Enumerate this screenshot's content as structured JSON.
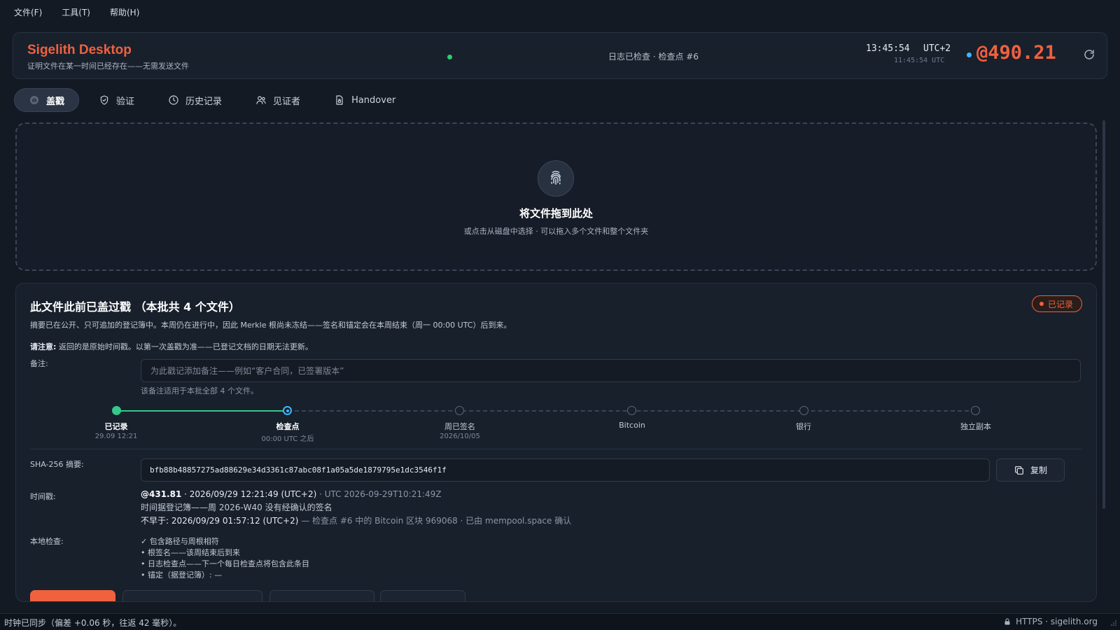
{
  "menu": {
    "file": "文件(F)",
    "tools": "工具(T)",
    "help": "帮助(H)"
  },
  "header": {
    "title": "Sigelith Desktop",
    "subtitle": "证明文件在某一时间已经存在——无需发送文件",
    "log_status": "日志已检查 · 检查点 #6",
    "clock_local": "13:45:54",
    "clock_tz": "UTC+2",
    "clock_utc": "11:45:54 UTC",
    "beat": "@490.21"
  },
  "tabs": [
    {
      "label": "盖戳",
      "icon": "fingerprint-icon",
      "active": true
    },
    {
      "label": "验证",
      "icon": "shield-check-icon"
    },
    {
      "label": "历史记录",
      "icon": "clock-icon"
    },
    {
      "label": "见证者",
      "icon": "users-icon"
    },
    {
      "label": "Handover",
      "icon": "file-lock-icon"
    }
  ],
  "dropzone": {
    "title": "将文件拖到此处",
    "hint": "或点击从磁盘中选择 · 可以拖入多个文件和整个文件夹"
  },
  "result": {
    "title": "此文件此前已盖过戳 （本批共 4 个文件）",
    "badge": "已记录",
    "description": "摘要已在公开、只可追加的登记簿中。本周仍在进行中，因此 Merkle 根尚未冻结——签名和锚定会在本周结束（周一 00:00 UTC）后到来。",
    "notice_label": "请注意:",
    "notice_text": "返回的是原始时间戳。以第一次盖戳为准——已登记文档的日期无法更新。",
    "note_label": "备注:",
    "note_placeholder": "为此戳记添加备注——例如“客户合同，已签署版本”",
    "note_help": "该备注适用于本批全部 4 个文件。",
    "steps": [
      {
        "label": "已记录",
        "sub": "29.09 12:21",
        "state": "done"
      },
      {
        "label": "检查点",
        "sub": "00:00 UTC 之后",
        "state": "current"
      },
      {
        "label": "周已签名",
        "sub": "2026/10/05",
        "state": "pending"
      },
      {
        "label": "Bitcoin",
        "sub": "",
        "state": "pending"
      },
      {
        "label": "银行",
        "sub": "",
        "state": "pending"
      },
      {
        "label": "独立副本",
        "sub": "",
        "state": "pending"
      }
    ],
    "sha_label": "SHA-256 摘要:",
    "sha_value": "bfb88b48857275ad88629e34d3361c87abc08f1a05a5de1879795e1dc3546f1f",
    "copy_label": "复制",
    "timestamp_label": "时间戳:",
    "ts_beat": "@431.81",
    "ts_local": " · 2026/09/29 12:21:49 (UTC+2)",
    "ts_utc": " · UTC 2026-09-29T10:21:49Z",
    "ts_line2": "时间据登记簿——周 2026-W40 没有经确认的签名",
    "ts_line3_prefix": "不早于: ",
    "ts_line3_time": "2026/09/29 01:57:12 (UTC+2)",
    "ts_line3_rest": " — 检查点 #6 中的 Bitcoin 区块 969068 · 已由 mempool.space 确认",
    "local_check_label": "本地检查:",
    "checks": [
      "✓ 包含路径与周根相符",
      "• 根签名——该周结束后到来",
      "• 日志检查点——下一个每日检查点将包含此条目",
      "• 锚定（据登记簿）: —"
    ]
  },
  "statusbar": {
    "sync": "时钟已同步（偏差 +0.06 秒，往返 42 毫秒）。",
    "secure": "HTTPS · sigelith.org"
  },
  "colors": {
    "accent": "#f0613e",
    "ok": "#34c88a",
    "info": "#3fb6ff",
    "bg": "#141a24"
  }
}
